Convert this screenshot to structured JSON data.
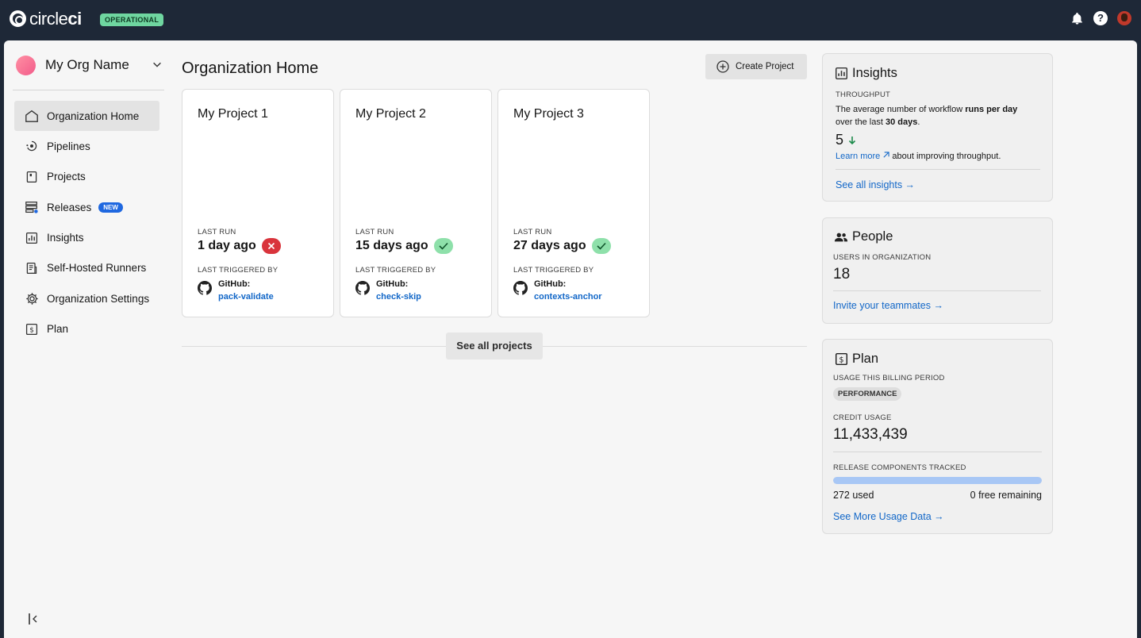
{
  "topbar": {
    "logo_text_light": "circle",
    "logo_text_bold": "ci",
    "status_badge": "OPERATIONAL",
    "icons": [
      "bell-icon",
      "help-icon",
      "user-avatar"
    ],
    "help_glyph": "?"
  },
  "sidebar": {
    "org_name": "My Org Name",
    "items": [
      {
        "label": "Organization Home",
        "icon": "home-icon",
        "active": true
      },
      {
        "label": "Pipelines",
        "icon": "pipelines-icon"
      },
      {
        "label": "Projects",
        "icon": "projects-icon"
      },
      {
        "label": "Releases",
        "icon": "releases-icon",
        "badge": "NEW"
      },
      {
        "label": "Insights",
        "icon": "insights-icon"
      },
      {
        "label": "Self-Hosted Runners",
        "icon": "runners-icon"
      },
      {
        "label": "Organization Settings",
        "icon": "gear-icon"
      },
      {
        "label": "Plan",
        "icon": "plan-icon"
      }
    ]
  },
  "main": {
    "title": "Organization Home",
    "create_button": "Create Project",
    "projects": [
      {
        "name": "My Project 1",
        "last_run_label": "LAST RUN",
        "last_run": "1 day ago",
        "status": "failed",
        "triggered_label": "LAST TRIGGERED BY",
        "source": "GitHub:",
        "branch": "pack-validate"
      },
      {
        "name": "My Project 2",
        "last_run_label": "LAST RUN",
        "last_run": "15 days ago",
        "status": "success",
        "triggered_label": "LAST TRIGGERED BY",
        "source": "GitHub:",
        "branch": "check-skip"
      },
      {
        "name": "My Project 3",
        "last_run_label": "LAST RUN",
        "last_run": "27 days ago",
        "status": "success",
        "triggered_label": "LAST TRIGGERED BY",
        "source": "GitHub:",
        "branch": "contexts-anchor"
      }
    ],
    "see_all_projects": "See all projects"
  },
  "insights": {
    "title": "Insights",
    "metric_label": "THROUGHPUT",
    "desc_1": "The average number of workflow ",
    "desc_bold_1": "runs per day",
    "desc_2": "over the last ",
    "desc_bold_2": "30 days",
    "desc_3": ".",
    "value": "5",
    "trend": "down",
    "learn_more": "Learn more",
    "learn_more_suffix": "about improving throughput.",
    "see_all": "See all insights →"
  },
  "people": {
    "title": "People",
    "users_label": "USERS IN ORGANIZATION",
    "users_count": "18",
    "invite": "Invite your teammates →"
  },
  "plan": {
    "title": "Plan",
    "usage_label": "USAGE THIS BILLING PERIOD",
    "plan_badge": "PERFORMANCE",
    "credit_label": "CREDIT USAGE",
    "credit_value": "11,433,439",
    "release_label": "RELEASE COMPONENTS TRACKED",
    "used": "272 used",
    "remaining": "0 free remaining",
    "usage_fraction": 1.0,
    "see_more": "See More Usage Data →"
  },
  "colors": {
    "topbar": "#1e2837",
    "operational": "#6fd6a0",
    "link": "#1267c8",
    "fail": "#d9343c",
    "success": "#8ee0aa",
    "progress": "#a8c7f5"
  }
}
